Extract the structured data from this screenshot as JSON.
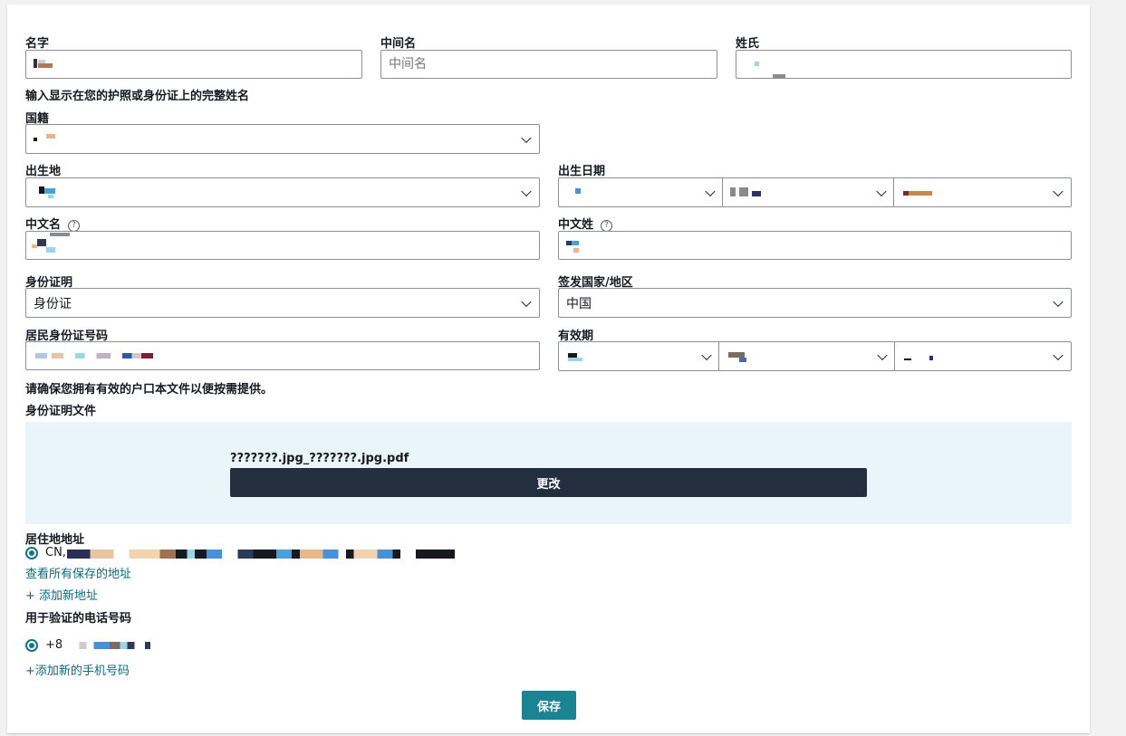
{
  "form": {
    "first_name": {
      "label": "名字"
    },
    "middle_name": {
      "label": "中间名",
      "placeholder": "中间名"
    },
    "last_name": {
      "label": "姓氏"
    },
    "name_hint": "输入显示在您的护照或身份证上的完整姓名",
    "nationality": {
      "label": "国籍"
    },
    "birthplace": {
      "label": "出生地"
    },
    "birth_date": {
      "label": "出生日期"
    },
    "chinese_given_name": {
      "label": "中文名",
      "help_icon": "question-circle-icon"
    },
    "chinese_surname": {
      "label": "中文姓",
      "help_icon": "question-circle-icon"
    },
    "id_type": {
      "label": "身份证明",
      "value": "身份证"
    },
    "issuing_country": {
      "label": "签发国家/地区",
      "value": "中国"
    },
    "id_number": {
      "label": "居民身份证号码"
    },
    "expiry": {
      "label": "有效期"
    },
    "hukou_note": "请确保您拥有有效的户口本文件以便按需提供。",
    "id_document": {
      "label": "身份证明文件",
      "file_name": "???????.jpg_???????.jpg.pdf",
      "change_button": "更改"
    },
    "address": {
      "label": "居住地地址",
      "selected_prefix": "CN,",
      "view_saved_link": "查看所有保存的地址",
      "add_new_link": "+ 添加新地址"
    },
    "phone": {
      "label": "用于验证的电话号码",
      "selected_prefix": "+8",
      "add_new_link": "+添加新的手机号码"
    },
    "save_button": "保存"
  },
  "colors": {
    "primary_button": "#1b8394",
    "dark_button": "#232f3e",
    "link": "#0a6b7a",
    "upload_bg": "#e9f4fb"
  }
}
